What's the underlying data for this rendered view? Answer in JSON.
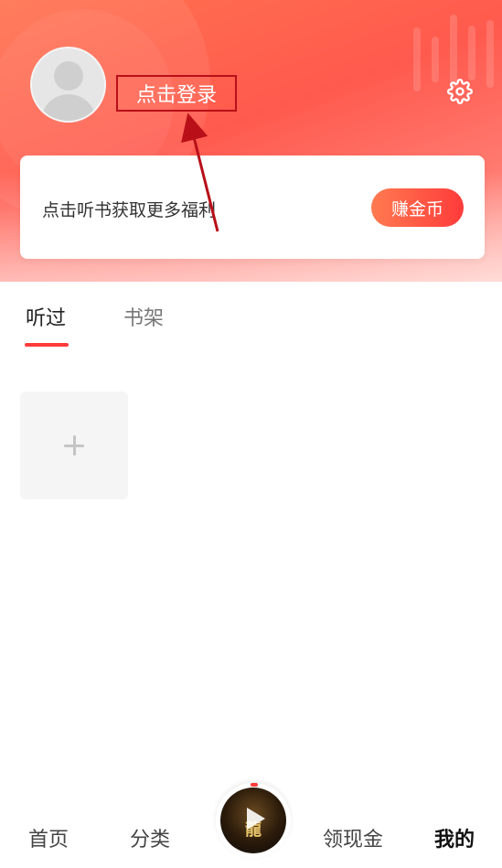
{
  "profile": {
    "login_label": "点击登录",
    "settings_icon": "gear-icon",
    "avatar_icon": "default-avatar-icon"
  },
  "benefit_card": {
    "text": "点击听书获取更多福利",
    "button_label": "赚金币"
  },
  "tabs": [
    {
      "label": "听过",
      "active": true
    },
    {
      "label": "书架",
      "active": false
    }
  ],
  "add_tile": {
    "icon": "plus-icon"
  },
  "bottom_nav": {
    "items": [
      {
        "label": "首页",
        "active": false
      },
      {
        "label": "分类",
        "active": false
      },
      {
        "label": "领现金",
        "active": false
      },
      {
        "label": "我的",
        "active": true
      }
    ],
    "player": {
      "icon": "play-icon",
      "cover_text": "龍"
    }
  },
  "colors": {
    "header_start": "#ff7350",
    "header_end": "#ff5a4e",
    "accent": "#ff3b3b",
    "annotation": "#b80f18"
  }
}
